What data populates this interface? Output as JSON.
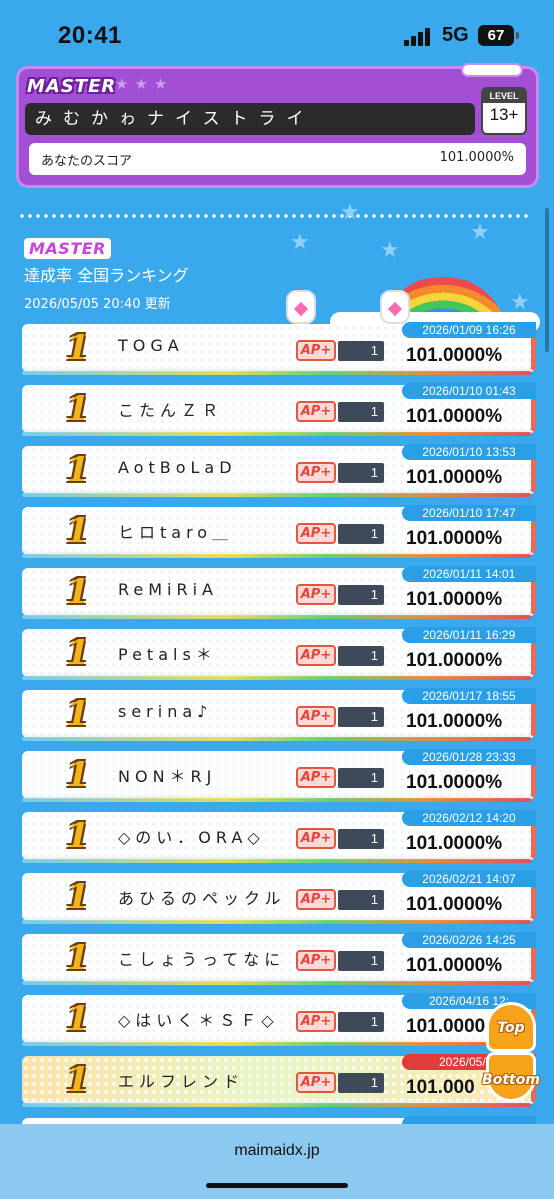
{
  "status": {
    "time": "20:41",
    "network": "5G",
    "battery": "67"
  },
  "song": {
    "difficulty": "MASTER",
    "title": "みむかゎナイストライ",
    "level_label": "LEVEL",
    "level": "13+",
    "score_label": "あなたのスコア",
    "score": "101.0000%"
  },
  "ranking": {
    "difficulty": "MASTER",
    "title": "達成率 全国ランキング",
    "updated": "2026/05/05 20:40 更新",
    "rows": [
      {
        "rank": "1",
        "player": "TOGA",
        "badge": "AP+",
        "count": "1",
        "date": "2026/01/09 16:26",
        "score": "101.0000%"
      },
      {
        "rank": "1",
        "player": "こたんＺＲ",
        "badge": "AP+",
        "count": "1",
        "date": "2026/01/10 01:43",
        "score": "101.0000%"
      },
      {
        "rank": "1",
        "player": "AotBoLaD",
        "badge": "AP+",
        "count": "1",
        "date": "2026/01/10 13:53",
        "score": "101.0000%"
      },
      {
        "rank": "1",
        "player": "ヒロtaro＿",
        "badge": "AP+",
        "count": "1",
        "date": "2026/01/10 17:47",
        "score": "101.0000%"
      },
      {
        "rank": "1",
        "player": "ReMiRiA",
        "badge": "AP+",
        "count": "1",
        "date": "2026/01/11 14:01",
        "score": "101.0000%"
      },
      {
        "rank": "1",
        "player": "Petals＊",
        "badge": "AP+",
        "count": "1",
        "date": "2026/01/11 16:29",
        "score": "101.0000%"
      },
      {
        "rank": "1",
        "player": "serina♪",
        "badge": "AP+",
        "count": "1",
        "date": "2026/01/17 18:55",
        "score": "101.0000%"
      },
      {
        "rank": "1",
        "player": "NON＊RJ",
        "badge": "AP+",
        "count": "1",
        "date": "2026/01/28 23:33",
        "score": "101.0000%"
      },
      {
        "rank": "1",
        "player": "◇のい．ORA◇",
        "badge": "AP+",
        "count": "1",
        "date": "2026/02/12 14:20",
        "score": "101.0000%"
      },
      {
        "rank": "1",
        "player": "あひるのペックル",
        "badge": "AP+",
        "count": "1",
        "date": "2026/02/21 14:07",
        "score": "101.0000%"
      },
      {
        "rank": "1",
        "player": "こしょうってなに",
        "badge": "AP+",
        "count": "1",
        "date": "2026/02/26 14:25",
        "score": "101.0000%"
      },
      {
        "rank": "1",
        "player": "◇はいく＊ＳＦ◇",
        "badge": "AP+",
        "count": "1",
        "date": "2026/04/16 12:",
        "score": "101.0000"
      },
      {
        "rank": "1",
        "player": "エルフレンド",
        "badge": "AP+",
        "count": "1",
        "date": "2026/05/05",
        "score": "101.000",
        "highlight": true
      }
    ]
  },
  "buttons": {
    "top": "Top",
    "bottom": "Bottom"
  },
  "browser": {
    "url": "maimaidx.jp"
  }
}
